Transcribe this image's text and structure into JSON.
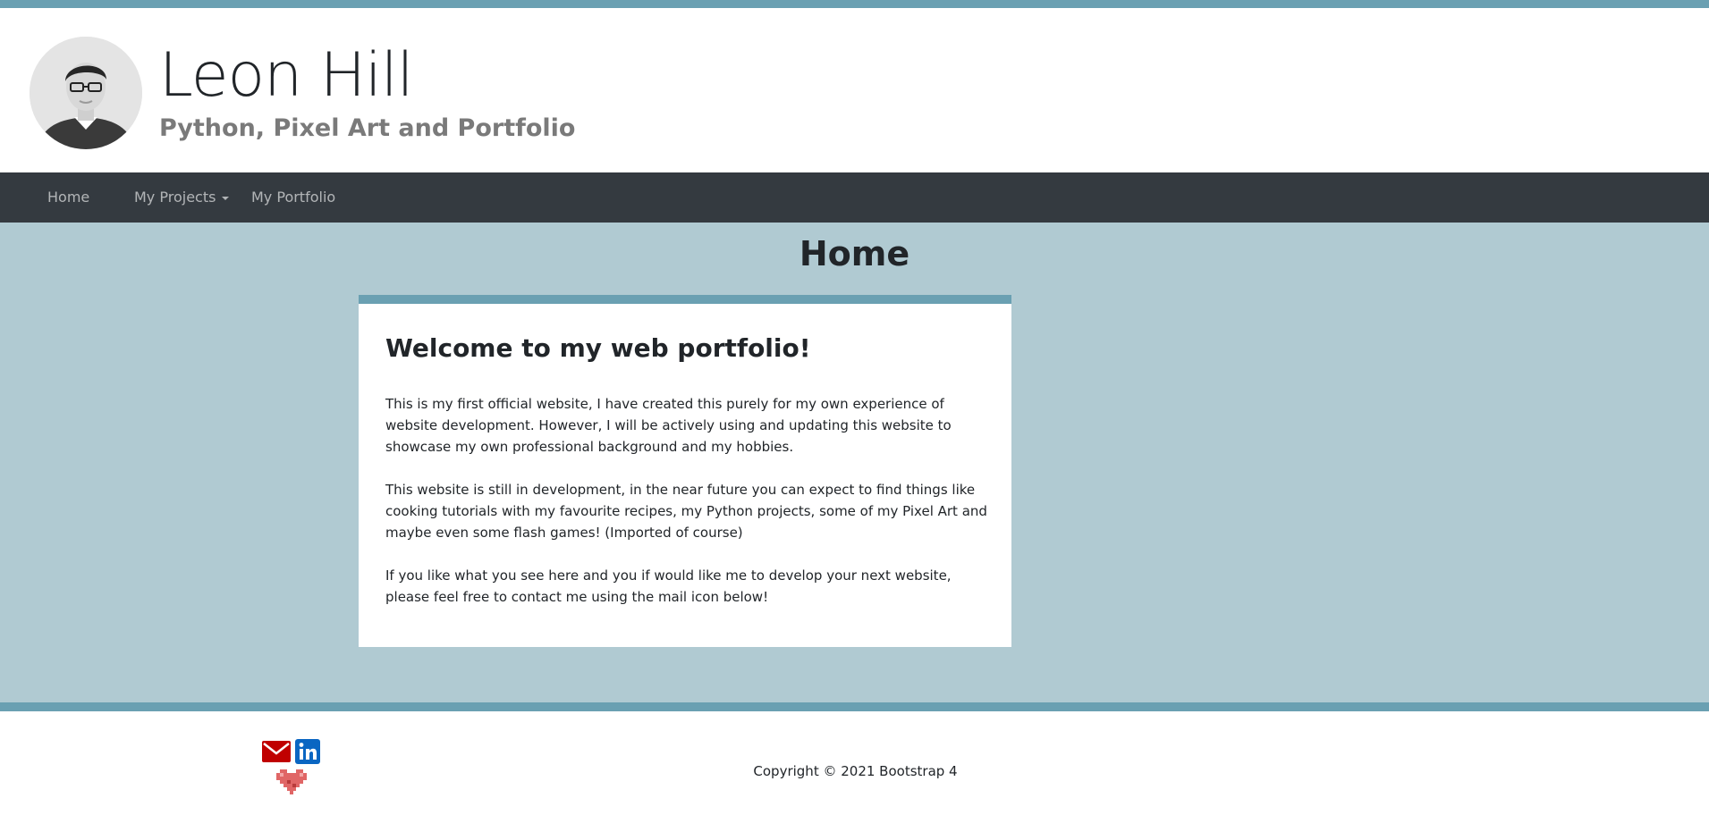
{
  "header": {
    "title": "Leon Hill",
    "subtitle": "Python, Pixel Art and Portfolio"
  },
  "nav": {
    "items": [
      {
        "label": "Home"
      },
      {
        "label": "My Projects"
      },
      {
        "label": "My Portfolio"
      }
    ]
  },
  "main": {
    "heading": "Home",
    "card": {
      "title": "Welcome to my web portfolio!",
      "paragraphs": [
        "This is my first official website, I have created this purely for my own experience of website development. However, I will be actively using and updating this website to showcase my own professional background and my hobbies.",
        "This website is still in development, in the near future you can expect to find things like cooking tutorials with my favourite recipes, my Python projects, some of my Pixel Art and maybe even some flash games! (Imported of course)",
        "If you like what you see here and you if would like me to develop your next website, please feel free to contact me using the mail icon below!"
      ]
    }
  },
  "footer": {
    "copyright": "Copyright © 2021 Bootstrap 4",
    "icons": [
      "mail-icon",
      "linkedin-icon",
      "pixel-heart-icon"
    ]
  },
  "colors": {
    "accent": "#6aa0b2",
    "main_bg": "#b0cad2",
    "navbar_bg": "#343a40",
    "mail_red": "#c00000",
    "linkedin_blue": "#0a66c2"
  }
}
